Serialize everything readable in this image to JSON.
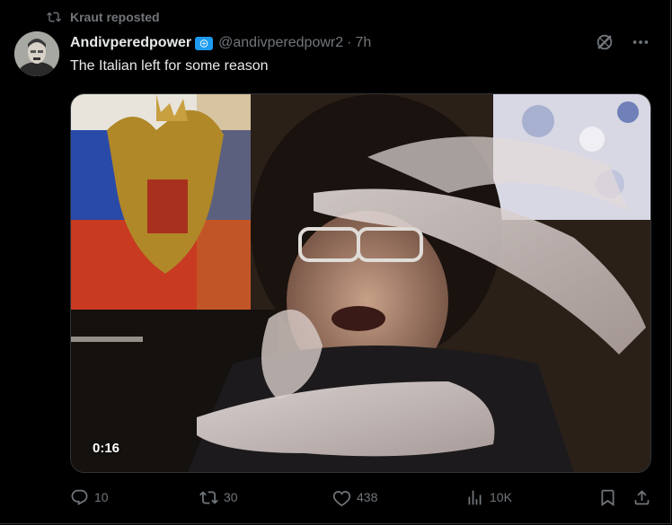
{
  "repost": {
    "label": "Kraut reposted",
    "icon": "repost-icon"
  },
  "author": {
    "display_name": "Andivperedpower",
    "badge_icon": "verified-badge-icon",
    "handle": "@andivperedpowr2",
    "separator": "·",
    "time": "7h"
  },
  "tweet": {
    "text": "The Italian left for some reason"
  },
  "media": {
    "type": "video",
    "duration": "0:16"
  },
  "actions": {
    "replies": "10",
    "reposts": "30",
    "likes": "438",
    "views": "10K"
  },
  "colors": {
    "background": "#000000",
    "text_primary": "#e7e9ea",
    "text_secondary": "#71767b",
    "verified": "#1d9bf0",
    "border": "#2f3336"
  }
}
